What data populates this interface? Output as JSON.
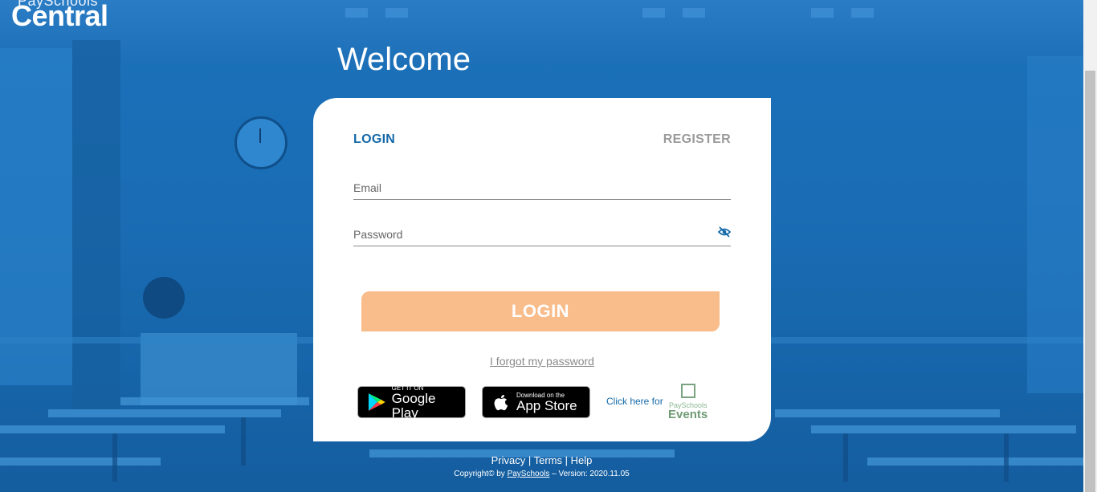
{
  "brand": {
    "small": "PaySchools",
    "big": "Central"
  },
  "welcome": "Welcome",
  "tabs": {
    "login": "LOGIN",
    "register": "REGISTER"
  },
  "fields": {
    "email_placeholder": "Email",
    "password_placeholder": "Password"
  },
  "login_button": "LOGIN",
  "forgot_link": "I forgot my password",
  "stores": {
    "google": {
      "line1": "GET IT ON",
      "line2": "Google Play"
    },
    "apple": {
      "line1": "Download on the",
      "line2": "App Store"
    }
  },
  "events": {
    "prompt": "Click here for",
    "logo_small": "PaySchools",
    "logo_big": "Events"
  },
  "footer": {
    "privacy": "Privacy",
    "terms": "Terms",
    "help": "Help",
    "separator": "|",
    "copyright_prefix": "Copyright© by ",
    "copyright_link": "PaySchools",
    "copyright_suffix": " – Version: 2020.11.05"
  },
  "colors": {
    "primary": "#1469a8",
    "button": "#f9bc8b",
    "background": "#1a6db5"
  }
}
